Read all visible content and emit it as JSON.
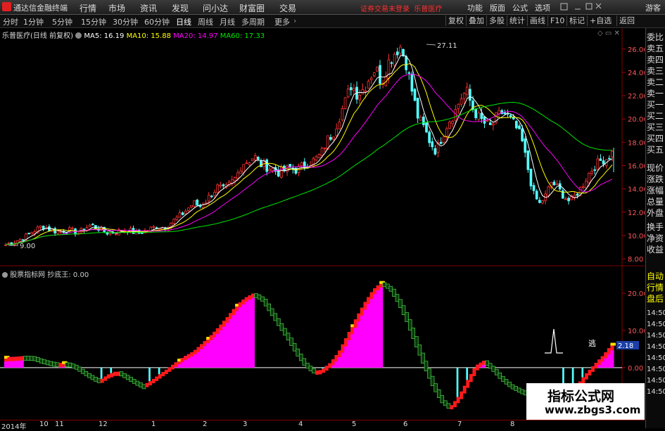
{
  "app": {
    "title": "通达信金融终端",
    "notice": "证券交易未登录",
    "stock_name": "乐普医疗",
    "guest": "游客"
  },
  "menu": {
    "items": [
      "行情",
      "市场",
      "资讯",
      "发现",
      "问小达",
      "财富圈",
      "交易"
    ]
  },
  "right_menu": {
    "items": [
      "功能",
      "版面",
      "公式",
      "选项"
    ]
  },
  "period_tabs": {
    "items": [
      "分时",
      "1分钟",
      "5分钟",
      "15分钟",
      "30分钟",
      "60分钟",
      "日线",
      "周线",
      "月线",
      "多周期",
      "更多"
    ],
    "active": "日线"
  },
  "right_tools": {
    "items": [
      "复权",
      "叠加",
      "多股",
      "统计",
      "画线",
      "F10",
      "标记",
      "+自选",
      "返回"
    ]
  },
  "legend": {
    "stock": "乐普医疗(日线 前复权)",
    "ma5": "MA5: 16.19",
    "ma10": "MA10: 15.88",
    "ma20": "MA20: 14.97",
    "ma60": "MA60: 17.33"
  },
  "sub_legend": {
    "name": "股票指标网",
    "value": "抄底王: 0.00"
  },
  "annotations": {
    "high": "27.11",
    "low": "9.00",
    "sub_value": "2.18",
    "sub_text": "逃"
  },
  "sidebar": {
    "items": [
      "委比",
      "卖五",
      "卖四",
      "卖三",
      "卖二",
      "卖一",
      "买一",
      "买二",
      "买三",
      "买四",
      "买五",
      "现价",
      "涨跌",
      "涨幅",
      "总量",
      "外盘",
      "换手",
      "净资",
      "收益"
    ],
    "extra": [
      "自动",
      "行情",
      "盘后",
      "14:50",
      "14:50",
      "14:50",
      "14:50",
      "14:50",
      "14:50",
      "14:50",
      "14:50"
    ]
  },
  "date_axis": {
    "labels": [
      "2014年",
      "10",
      "11",
      "12",
      "1",
      "2",
      "3",
      "4",
      "5",
      "6",
      "7",
      "8"
    ]
  },
  "watermark": {
    "line1": "指标公式网",
    "line2": "www.zbgs3.com"
  },
  "colors": {
    "up": "#ff3232",
    "down": "#54ffff",
    "ma5": "#ffffff",
    "ma10": "#ffff00",
    "ma20": "#ff00ff",
    "ma60": "#00e600",
    "bg": "#000000"
  },
  "chart_data": [
    {
      "type": "candlestick",
      "title": "乐普医疗(日线 前复权)",
      "y_ticks": [
        8.0,
        10.0,
        12.0,
        14.0,
        16.0,
        18.0,
        20.0,
        22.0,
        24.0,
        26.0
      ],
      "ylim": [
        7.4,
        27.8
      ],
      "close_approx": [
        9.2,
        9.4,
        9.6,
        9.8,
        10.2,
        10.5,
        10.8,
        10.6,
        10.4,
        10.3,
        10.5,
        10.4,
        10.2,
        10.6,
        10.9,
        10.7,
        10.4,
        10.2,
        10.3,
        10.4,
        10.5,
        10.3,
        10.2,
        10.4,
        10.6,
        10.8,
        10.7,
        11.0,
        11.4,
        11.8,
        12.3,
        12.8,
        12.5,
        13.0,
        13.6,
        14.2,
        13.9,
        14.4,
        15.0,
        16.2,
        16.4,
        16.8,
        16.1,
        15.9,
        15.7,
        15.4,
        15.6,
        15.8,
        15.6,
        16.0,
        16.2,
        16.5,
        17.0,
        18.2,
        18.8,
        20.2,
        21.5,
        23.0,
        22.1,
        22.6,
        23.6,
        24.4,
        23.1,
        24.8,
        25.6,
        26.3,
        24.9,
        22.4,
        20.1,
        19.2,
        18.0,
        17.2,
        18.6,
        19.8,
        20.5,
        21.8,
        22.4,
        20.9,
        20.1,
        19.6,
        19.3,
        20.2,
        20.6,
        20.1,
        19.4,
        18.4,
        16.0,
        13.6,
        12.7,
        13.4,
        14.6,
        14.1,
        13.4,
        12.9,
        13.5,
        14.2,
        15.2,
        15.9,
        16.4,
        16.6,
        17.1
      ],
      "ma": [
        {
          "name": "MA5",
          "value": 16.19,
          "color": "#ffffff"
        },
        {
          "name": "MA10",
          "value": 15.88,
          "color": "#ffff00"
        },
        {
          "name": "MA20",
          "value": 14.97,
          "color": "#ff00ff"
        },
        {
          "name": "MA60",
          "value": 17.33,
          "color": "#00e600"
        }
      ],
      "high_label": 27.11,
      "low_label": 9.0
    },
    {
      "type": "indicator",
      "title": "抄底王",
      "y_ticks": [
        0.0,
        10.0,
        20.0
      ],
      "ylim": [
        -14.0,
        27.0
      ],
      "values": [
        2.8,
        2.9,
        3.1,
        3.0,
        2.2,
        1.6,
        1.2,
        1.4,
        0.6,
        -1.0,
        -2.4,
        -3.4,
        -1.8,
        -0.9,
        -2.2,
        -3.6,
        -4.8,
        -3.5,
        -1.8,
        -0.2,
        1.6,
        3.1,
        4.4,
        6.5,
        8.6,
        11.1,
        13.8,
        16.7,
        18.7,
        20.0,
        18.6,
        15.2,
        11.6,
        8.2,
        4.3,
        1.0,
        -0.9,
        -0.6,
        1.3,
        4.3,
        8.7,
        13.2,
        17.4,
        20.9,
        23.0,
        21.4,
        17.7,
        12.7,
        6.6,
        0.8,
        -4.5,
        -8.7,
        -10.7,
        -7.8,
        -3.7,
        0.5,
        1.9,
        -0.2,
        -2.7,
        -4.6,
        -5.8,
        -6.7,
        -7.4,
        -8.6,
        -12.3,
        -10.8,
        -6.9,
        -4.4,
        -1.5,
        1.0,
        3.4,
        6.3
      ],
      "peak_label": 2.18
    }
  ]
}
